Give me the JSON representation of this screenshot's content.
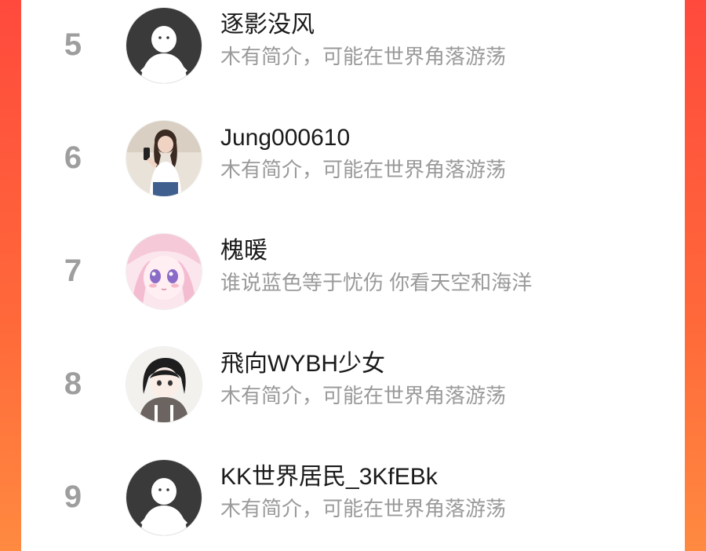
{
  "ranking": {
    "rows": [
      {
        "rank": "5",
        "name": "逐影没风",
        "desc": "木有简介，可能在世界角落游荡",
        "avatar_icon": "default-user-avatar-icon"
      },
      {
        "rank": "6",
        "name": "Jung000610",
        "desc": "木有简介，可能在世界角落游荡",
        "avatar_icon": "photo-avatar-icon"
      },
      {
        "rank": "7",
        "name": "槐暖",
        "desc": "谁说蓝色等于忧伤 你看天空和海洋",
        "avatar_icon": "anime-avatar-icon"
      },
      {
        "rank": "8",
        "name": "飛向WYBH少女",
        "desc": "木有简介，可能在世界角落游荡",
        "avatar_icon": "anime-avatar-icon"
      },
      {
        "rank": "9",
        "name": "KK世界居民_3KfEBk",
        "desc": "木有简介，可能在世界角落游荡",
        "avatar_icon": "default-user-avatar-icon"
      }
    ]
  },
  "colors": {
    "background_gradient_top": "#ff4a3d",
    "background_gradient_bottom": "#ff8a40",
    "card": "#ffffff",
    "rank_text": "#9e9e9e",
    "name_text": "#1a1a1a",
    "desc_text": "#9a9a9a",
    "default_avatar_bg": "#3a3a3a"
  }
}
